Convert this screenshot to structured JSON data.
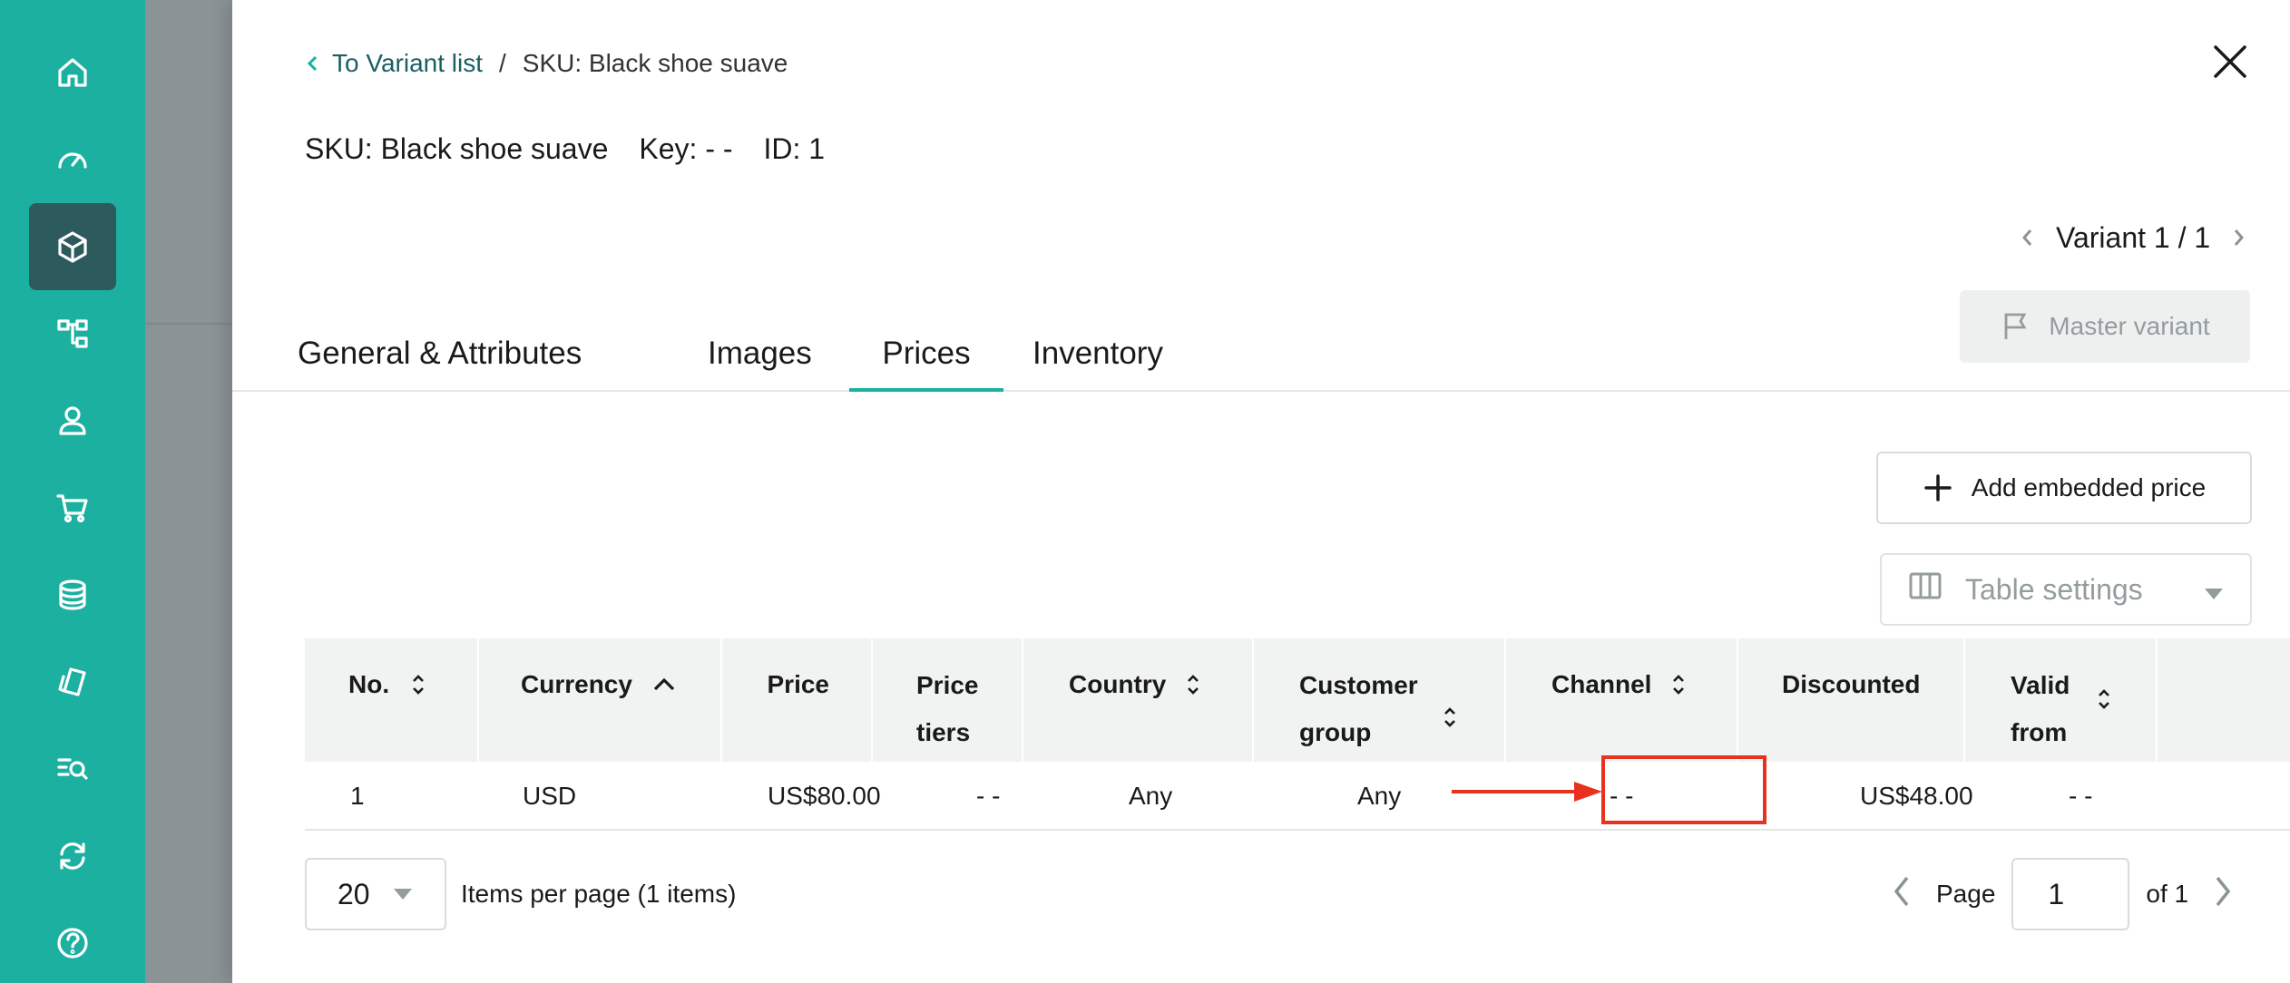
{
  "nav": {
    "icons": [
      "home-icon",
      "dashboard-icon",
      "products-icon",
      "categories-icon",
      "customers-icon",
      "orders-icon",
      "discounts-icon",
      "content-icon",
      "search-icon",
      "operations-icon",
      "help-icon"
    ],
    "active": "products-icon"
  },
  "breadcrumb": {
    "back_label": "To Variant list",
    "separator": "/",
    "current": "SKU: Black shoe suave"
  },
  "header": {
    "sku": "SKU: Black shoe suave",
    "key": "Key: - -",
    "id": "ID: 1"
  },
  "variant_nav": {
    "label": "Variant 1 / 1"
  },
  "master_variant_label": "Master variant",
  "tabs": [
    {
      "label": "General & Attributes"
    },
    {
      "label": "Images"
    },
    {
      "label": "Prices",
      "active": true
    },
    {
      "label": "Inventory"
    }
  ],
  "add_price_label": "Add embedded price",
  "table_settings_label": "Table settings",
  "table": {
    "columns": [
      {
        "l1": "No.",
        "l2": ""
      },
      {
        "l1": "Currency",
        "l2": ""
      },
      {
        "l1": "Price",
        "l2": ""
      },
      {
        "l1": "Price",
        "l2": "tiers"
      },
      {
        "l1": "Country",
        "l2": ""
      },
      {
        "l1": "Customer",
        "l2": "group"
      },
      {
        "l1": "Channel",
        "l2": ""
      },
      {
        "l1": "Discounted",
        "l2": ""
      },
      {
        "l1": "Valid",
        "l2": "from"
      }
    ],
    "rows": [
      [
        "1",
        "USD",
        "US$80.00",
        "- -",
        "Any",
        "Any",
        "- -",
        "US$48.00",
        "- -"
      ]
    ]
  },
  "pagination": {
    "per_page": "20",
    "per_page_label": "Items per page (1 items)",
    "page_label": "Page",
    "page_value": "1",
    "of_label": "of 1"
  },
  "colors": {
    "nav_bg": "#1cb0a0",
    "nav_active": "#2c5a5d",
    "accent": "#1cb0a0",
    "highlight": "#e8311f"
  }
}
